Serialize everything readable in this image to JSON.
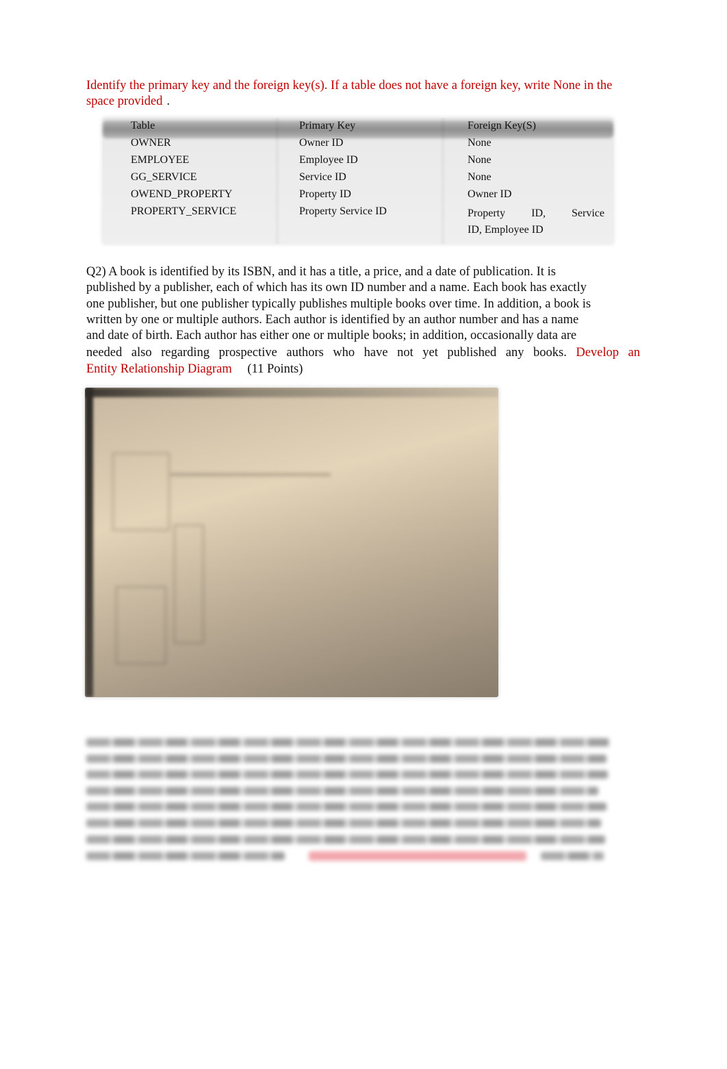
{
  "intro": {
    "instruction": "Identify the primary key and the foreign key(s). If a table does not have a foreign key, write None in the space provided",
    "trailing": "."
  },
  "keys_table": {
    "headers": [
      "Table",
      "Primary Key",
      "Foreign Key(S)"
    ],
    "rows": [
      {
        "table": "OWNER",
        "primary_key": "Owner ID",
        "foreign_keys": "None"
      },
      {
        "table": "EMPLOYEE",
        "primary_key": "Employee ID",
        "foreign_keys": "None"
      },
      {
        "table": "GG_SERVICE",
        "primary_key": "Service ID",
        "foreign_keys": "None"
      },
      {
        "table": "OWEND_PROPERTY",
        "primary_key": "Property ID",
        "foreign_keys": "Owner ID"
      },
      {
        "table": "PROPERTY_SERVICE",
        "primary_key": "Property Service ID",
        "foreign_keys_line1": "Property ID, Service",
        "foreign_keys_line2": "ID, Employee ID"
      }
    ]
  },
  "q2": {
    "lines": [
      "Q2) A book is identified by its ISBN, and it has a title, a price, and a date of publication. It is",
      "published by a publisher, each of which has its own ID number and a name. Each book has exactly",
      "one publisher, but one publisher typically publishes multiple books over time. In addition, a book is",
      "written by one or multiple authors. Each author is identified by an author number and has a name",
      "and date of birth. Each author has either one or multiple books; in addition, occasionally data are"
    ],
    "last_line_text": "needed also regarding prospective authors who have not yet published any books.",
    "task_red_part1": "Develop an",
    "task_red_part2": "Entity Relationship Diagram",
    "points": "(11 Points)"
  },
  "answer_image": {
    "description": "Blurred photo of a hand-drawn entity relationship diagram on paper"
  },
  "q3": {
    "status": "blurred (unreadable) question text with red task phrase"
  }
}
